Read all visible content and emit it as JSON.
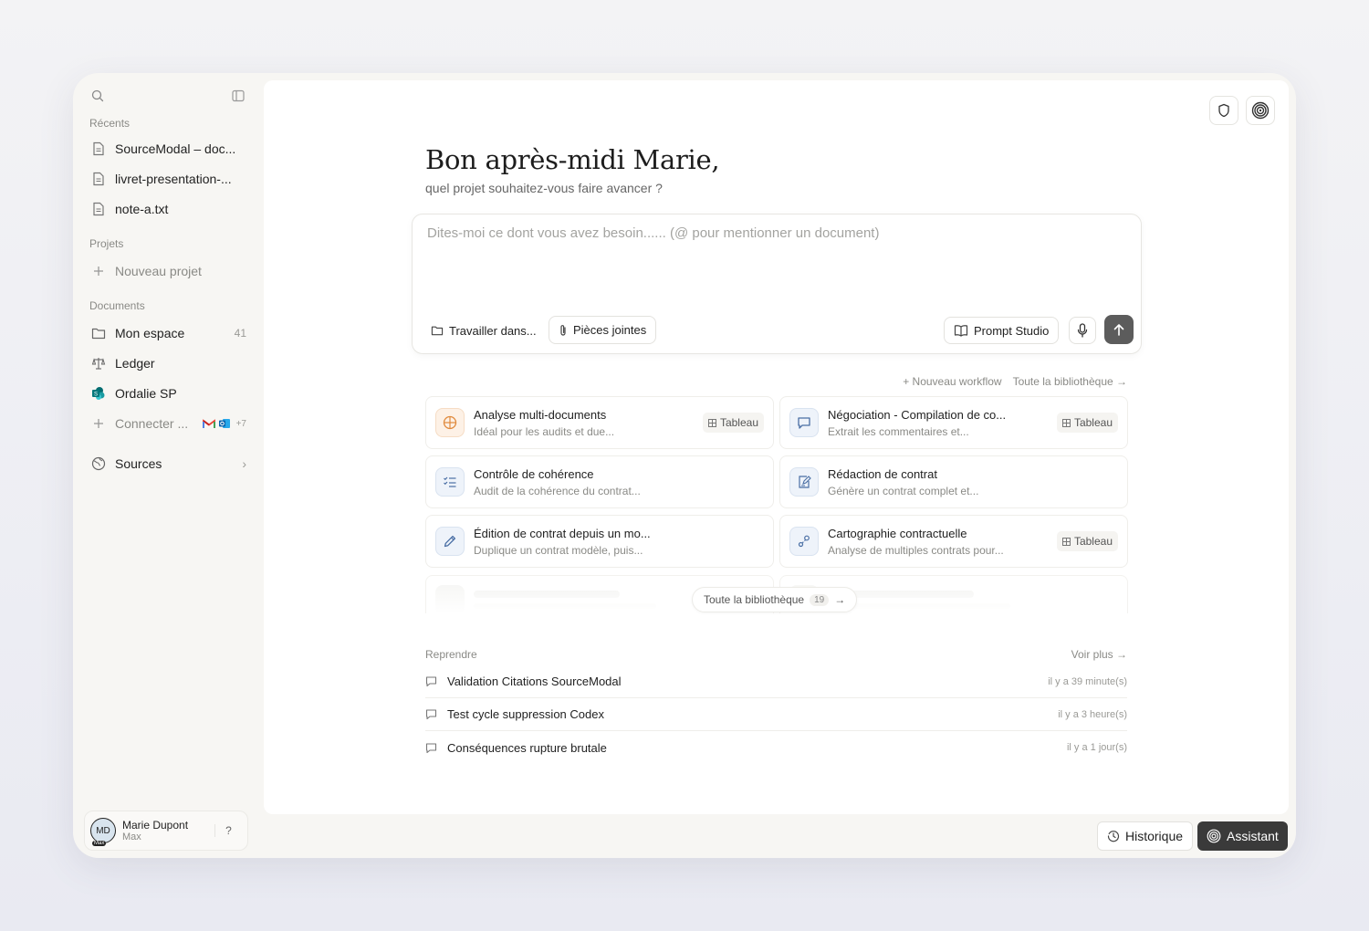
{
  "sidebar": {
    "sections": {
      "recents": "Récents",
      "projects": "Projets",
      "documents": "Documents"
    },
    "recents": [
      {
        "label": "SourceModal – doc..."
      },
      {
        "label": "livret-presentation-..."
      },
      {
        "label": "note-a.txt"
      }
    ],
    "new_project": "Nouveau projet",
    "documents": [
      {
        "label": "Mon espace",
        "count": "41"
      },
      {
        "label": "Ledger"
      },
      {
        "label": "Ordalie SP"
      }
    ],
    "connect": {
      "label": "Connecter ...",
      "extra": "+7"
    },
    "sources": "Sources",
    "user": {
      "initials": "MD",
      "badge": "Max",
      "name": "Marie Dupont",
      "plan": "Max",
      "help": "?"
    }
  },
  "main": {
    "greeting": "Bon après-midi Marie,",
    "subtitle": "quel projet souhaitez-vous faire avancer ?",
    "composer": {
      "placeholder": "Dites-moi ce dont vous avez besoin...... (@ pour mentionner un document)",
      "work_in": "Travailler dans...",
      "attachments": "Pièces jointes",
      "prompt_studio": "Prompt Studio"
    },
    "links": {
      "new_workflow": "+ Nouveau workflow",
      "library": "Toute la bibliothèque →"
    },
    "workflows": [
      {
        "title": "Analyse multi-documents",
        "desc": "Idéal pour les audits et due...",
        "tag": "Tableau"
      },
      {
        "title": "Négociation - Compilation de co...",
        "desc": "Extrait les commentaires et...",
        "tag": "Tableau"
      },
      {
        "title": "Contrôle de cohérence",
        "desc": "Audit de la cohérence du contrat...",
        "tag": ""
      },
      {
        "title": "Rédaction de contrat",
        "desc": "Génère un contrat complet et...",
        "tag": ""
      },
      {
        "title": "Édition de contrat depuis un mo...",
        "desc": "Duplique un contrat modèle, puis...",
        "tag": ""
      },
      {
        "title": "Cartographie contractuelle",
        "desc": "Analyse de multiples contrats pour...",
        "tag": "Tableau"
      }
    ],
    "library_pill": {
      "label": "Toute la bibliothèque",
      "count": "19"
    },
    "resume": {
      "title": "Reprendre",
      "more": "Voir plus →",
      "items": [
        {
          "title": "Validation Citations SourceModal",
          "time": "il y a 39 minute(s)"
        },
        {
          "title": "Test cycle suppression Codex",
          "time": "il y a 3 heure(s)"
        },
        {
          "title": "Conséquences rupture brutale",
          "time": "il y a 1 jour(s)"
        }
      ]
    }
  },
  "bottom": {
    "history": "Historique",
    "assistant": "Assistant"
  },
  "colors": {
    "accent_dark": "#3a3a3a",
    "orange_icon": "#e08a3c",
    "blue_icon": "#4a6fa5"
  }
}
